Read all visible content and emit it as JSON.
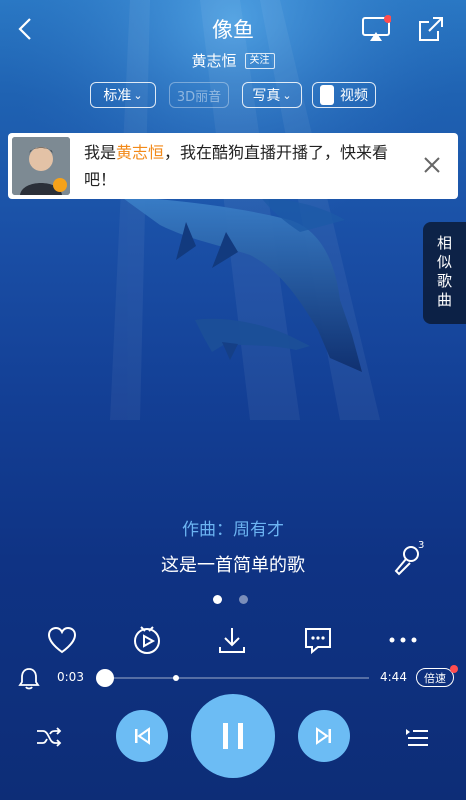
{
  "header": {
    "song_title": "像鱼",
    "artist": "黄志恒",
    "follow_label": "关注"
  },
  "options": {
    "quality": "标准",
    "surround": "3D丽音",
    "mode": "写真",
    "video": "视频"
  },
  "notice": {
    "prefix": "我是",
    "highlight": "黄志恒",
    "suffix": "，我在酷狗直播开播了，快来看吧！"
  },
  "side_tab": {
    "label": "相似歌曲"
  },
  "lyrics": {
    "composer": "作曲：周有才",
    "line": "这是一首简单的歌"
  },
  "mic_badge": "3",
  "progress": {
    "current": "0:03",
    "total": "4:44",
    "fraction": 0.011,
    "speed_label": "倍速"
  },
  "colors": {
    "accent": "#6cbcf4",
    "highlight": "#f28a1a",
    "composer": "#6cb4f2",
    "badge": "#ff4d4f"
  }
}
